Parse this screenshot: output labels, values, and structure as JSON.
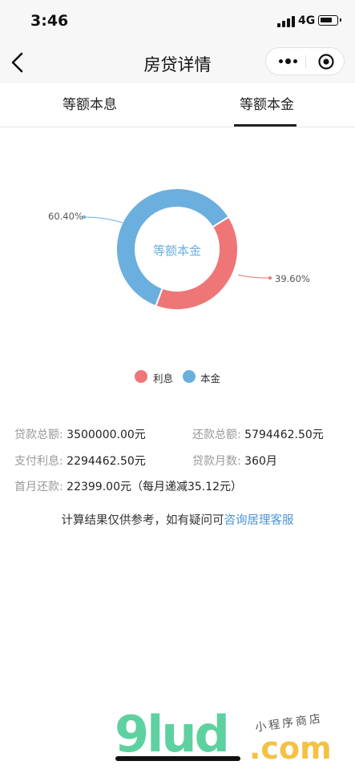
{
  "status_bar": {
    "time": "3:46",
    "network": "4G"
  },
  "nav": {
    "title": "房贷详情"
  },
  "tabs": [
    {
      "label": "等额本息",
      "active": false
    },
    {
      "label": "等额本金",
      "active": true
    }
  ],
  "chart_data": {
    "type": "pie",
    "center_label": "等额本金",
    "slices": [
      {
        "name": "利息",
        "value": 39.6,
        "label": "39.60%",
        "color": "#ee7677"
      },
      {
        "name": "本金",
        "value": 60.4,
        "label": "60.40%",
        "color": "#6aafdd"
      }
    ]
  },
  "legend": [
    {
      "label": "利息",
      "color": "#ee7677"
    },
    {
      "label": "本金",
      "color": "#6aafdd"
    }
  ],
  "info": {
    "loan_total": {
      "label": "贷款总额:",
      "value": "3500000.00元"
    },
    "repay_total": {
      "label": "还款总额:",
      "value": "5794462.50元"
    },
    "interest": {
      "label": "支付利息:",
      "value": "2294462.50元"
    },
    "months": {
      "label": "贷款月数:",
      "value": "360月"
    },
    "first_month": {
      "label": "首月还款:",
      "value": "22399.00元（每月递减35.12元）"
    }
  },
  "note": {
    "text": "计算结果仅供参考，如有疑问可",
    "link": "咨询居理客服"
  },
  "watermark": {
    "brand": "9lud",
    "suffix": ".com",
    "sub": "小程序商店"
  },
  "icons": {
    "back": "chevron-left-icon",
    "more": "more-dots-icon",
    "close": "target-icon"
  }
}
